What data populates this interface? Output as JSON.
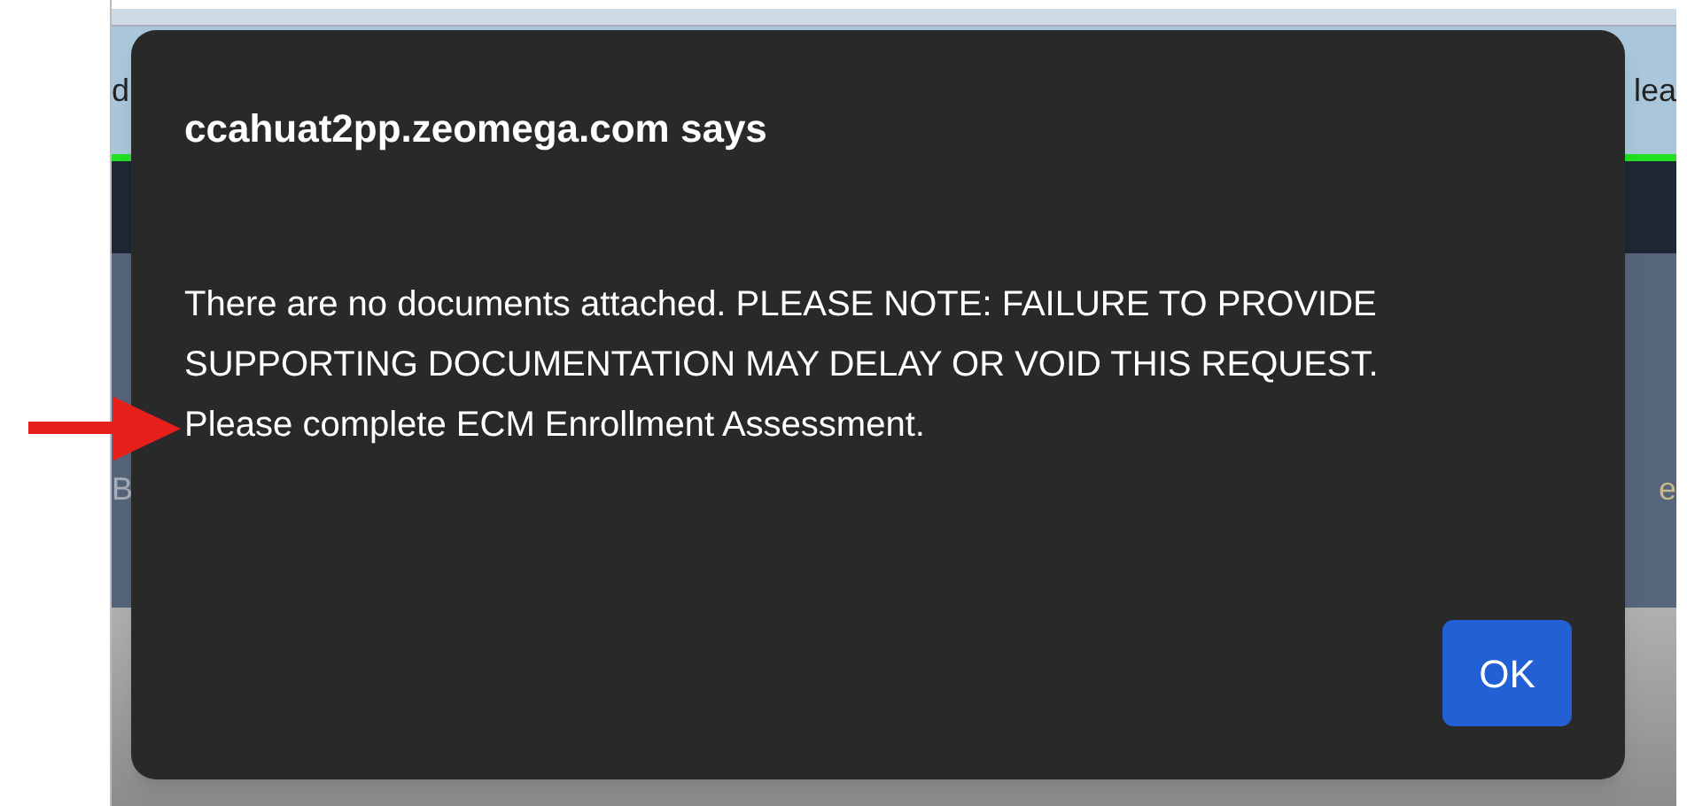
{
  "background": {
    "header_left_fragment": "d",
    "header_right_fragment": "lea",
    "row_left_fragment": "B",
    "row_right_fragment": "e"
  },
  "dialog": {
    "title": "ccahuat2pp.zeomega.com says",
    "message": [
      "There are no documents attached. PLEASE NOTE: FAILURE TO PROVIDE SUPPORTING DOCUMENTATION MAY DELAY OR VOID THIS REQUEST.",
      "Please complete ECM Enrollment Assessment."
    ],
    "buttons": [
      "OK"
    ]
  },
  "annotation": {
    "kind": "arrow",
    "color": "#e8201c"
  }
}
